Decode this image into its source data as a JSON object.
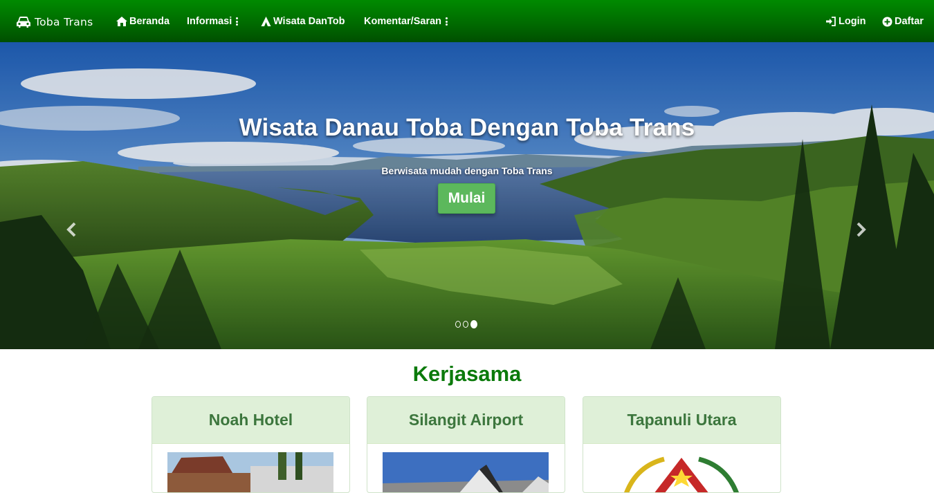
{
  "navbar": {
    "brand": "Toba Trans",
    "items": [
      {
        "label": "Beranda"
      },
      {
        "label": "Informasi"
      },
      {
        "label": "Wisata DanTob"
      },
      {
        "label": "Komentar/Saran"
      }
    ],
    "login": "Login",
    "register": "Daftar"
  },
  "hero": {
    "title": "Wisata Danau Toba Dengan Toba Trans",
    "subtitle": "Berwisata mudah dengan Toba Trans",
    "button": "Mulai",
    "slide_count": 3,
    "active_slide": 3
  },
  "section": {
    "title": "Kerjasama",
    "cards": [
      {
        "title": "Noah Hotel"
      },
      {
        "title": "Silangit Airport"
      },
      {
        "title": "Tapanuli Utara"
      }
    ]
  },
  "colors": {
    "navbar": "#007a00",
    "accent_green": "#5cb85c",
    "section_title": "#0b7a0b",
    "card_header_bg": "#dff0d8",
    "card_header_text": "#3c763d"
  }
}
